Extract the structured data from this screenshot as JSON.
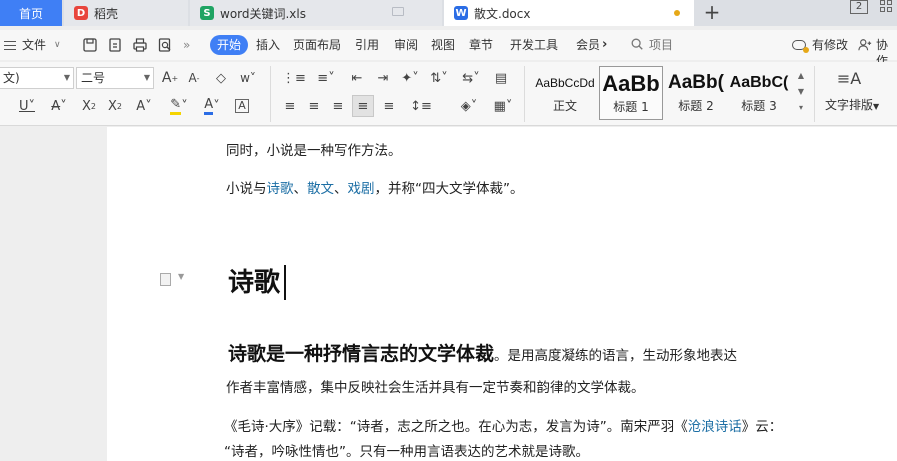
{
  "tabs": {
    "home": "首页",
    "daoke": "稻壳",
    "xls": "word关键词.xls",
    "doc": "散文.docx",
    "new_tab": "+",
    "window_badge": "2"
  },
  "menu": {
    "file": "文件",
    "start": "开始",
    "insert": "插入",
    "layout": "页面布局",
    "reference": "引用",
    "review": "审阅",
    "view": "视图",
    "chapter": "章节",
    "dev_tools": "开发工具",
    "member": "会员",
    "search": "项目",
    "has_changes": "有修改",
    "collab": "协作"
  },
  "ribbon": {
    "font_name": "文)",
    "font_size": "二号",
    "styles": [
      {
        "sample": "AaBbCcDd",
        "name": "正文"
      },
      {
        "sample": "AaBb",
        "name": "标题 1"
      },
      {
        "sample": "AaBb(",
        "name": "标题 2"
      },
      {
        "sample": "AaBbC(",
        "name": "标题 3"
      }
    ],
    "text_layout": "文字排版"
  },
  "document": {
    "line_partial": "同时，小说是一种写作方法。",
    "novel_line": {
      "prefix": "小说与",
      "link1": "诗歌",
      "sep1": "、",
      "link2": "散文",
      "sep2": "、",
      "link3": "戏剧",
      "suffix": "，并称“四大文学体裁”。"
    },
    "heading": "诗歌",
    "def_bold": "诗歌是一种抒情言志的文学体裁",
    "def_rest": "。是用高度凝练的语言，生动形象地表达",
    "def_line2": "作者丰富情感，集中反映社会生活并具有一定节奏和韵律的文学体裁。",
    "quote_line1": {
      "prefix": "《毛诗·大序》记载：“诗者，志之所之也。在心为志，发言为诗”。南宋严羽《",
      "link": "沧浪诗话",
      "suffix": "》云："
    },
    "quote_line2": "“诗者，吟咏性情也”。只有一种用言语表达的艺术就是诗歌。"
  },
  "colors": {
    "accent": "#3f7ff5",
    "link": "#1d6fa5",
    "xls_green": "#1fa463",
    "doc_blue": "#2b6de5",
    "daoke_red": "#e8453c",
    "unsaved_dot": "#e6a817"
  }
}
